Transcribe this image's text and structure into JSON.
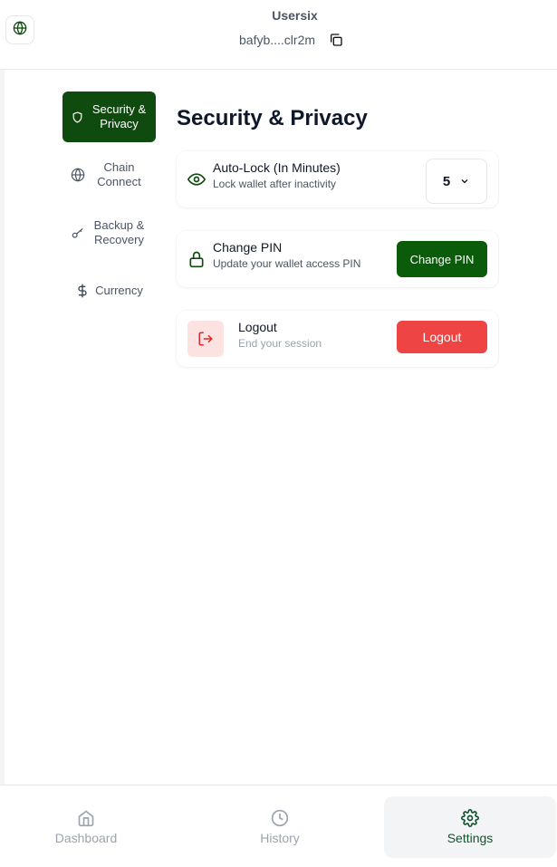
{
  "header": {
    "user_name": "Usersix",
    "address": "bafyb....clr2m",
    "icons": {
      "globe": "globe-icon",
      "copy": "copy-icon"
    }
  },
  "sidebar": {
    "items": [
      {
        "label": "Security & Privacy",
        "icon": "shield-icon",
        "active": true
      },
      {
        "label": "Chain Connect",
        "icon": "globe-icon",
        "active": false
      },
      {
        "label": "Backup & Recovery",
        "icon": "key-icon",
        "active": false
      },
      {
        "label": "Currency",
        "icon": "dollar-icon",
        "active": false
      }
    ]
  },
  "main": {
    "title": "Security & Privacy",
    "auto_lock": {
      "title": "Auto-Lock (In Minutes)",
      "subtitle": "Lock wallet after inactivity",
      "value": "5",
      "icon": "eye-icon"
    },
    "change_pin": {
      "title": "Change PIN",
      "subtitle": "Update your wallet access PIN",
      "button_label": "Change PIN",
      "icon": "lock-icon"
    },
    "logout": {
      "title": "Logout",
      "subtitle": "End your session",
      "button_label": "Logout",
      "icon": "logout-icon"
    }
  },
  "bottom_nav": {
    "tabs": [
      {
        "label": "Dashboard",
        "icon": "home-icon",
        "active": false
      },
      {
        "label": "History",
        "icon": "clock-icon",
        "active": false
      },
      {
        "label": "Settings",
        "icon": "gear-icon",
        "active": true
      }
    ]
  },
  "colors": {
    "primary_green": "#0a5c0a",
    "active_nav_bg": "#0f4a0f",
    "danger": "#ef4444",
    "danger_bg": "#fde2e2"
  }
}
